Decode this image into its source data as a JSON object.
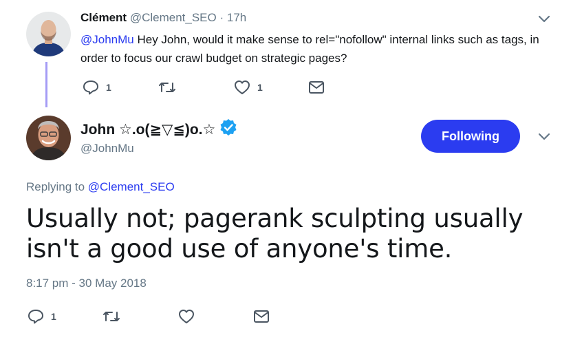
{
  "parent_tweet": {
    "author_name": "Clément",
    "author_handle": "@Clement_SEO",
    "separator": "·",
    "time": "17h",
    "mention": "@JohnMu",
    "text": " Hey John, would it make sense to rel=\"nofollow\" internal links such as tags, in order to focus our crawl budget on strategic pages?",
    "actions": {
      "reply_count": "1",
      "retweet_count": "",
      "like_count": "1"
    },
    "icons": [
      "reply-icon",
      "retweet-icon",
      "like-icon",
      "message-icon",
      "chevron-down-icon"
    ]
  },
  "main_tweet": {
    "author_name": "John ☆.o(≧▽≦)o.☆",
    "author_handle": "@JohnMu",
    "verified": true,
    "follow_button_label": "Following",
    "replying_prefix": "Replying to ",
    "replying_to": "@Clement_SEO",
    "text": "Usually not; pagerank sculpting usually isn't a good use of anyone's time.",
    "timestamp": "8:17 pm - 30 May 2018",
    "actions": {
      "reply_count": "1",
      "retweet_count": "",
      "like_count": ""
    }
  },
  "colors": {
    "accent": "#2b3cf0",
    "thread_line": "#a49bf5",
    "muted": "#657786",
    "verified": "#1da1f2",
    "icon": "#4a5561"
  }
}
